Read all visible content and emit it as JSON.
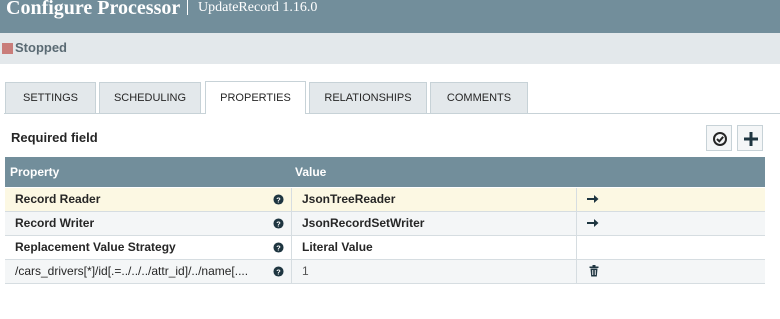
{
  "header": {
    "title": "Configure Processor",
    "subtitle": "UpdateRecord 1.16.0"
  },
  "status": {
    "label": "Stopped",
    "color": "#c97d7a"
  },
  "tabs": [
    {
      "label": "SETTINGS",
      "active": false
    },
    {
      "label": "SCHEDULING",
      "active": false
    },
    {
      "label": "PROPERTIES",
      "active": true
    },
    {
      "label": "RELATIONSHIPS",
      "active": false
    },
    {
      "label": "COMMENTS",
      "active": false
    }
  ],
  "properties_panel": {
    "required_label": "Required field",
    "verify_icon": "check-circle-icon",
    "add_icon": "plus-icon"
  },
  "grid": {
    "columns": [
      "Property",
      "Value"
    ],
    "rows": [
      {
        "name": "Record Reader",
        "value": "JsonTreeReader",
        "required": true,
        "action_icon": "arrow-right-icon"
      },
      {
        "name": "Record Writer",
        "value": "JsonRecordSetWriter",
        "required": true,
        "action_icon": "arrow-right-icon"
      },
      {
        "name": "Replacement Value Strategy",
        "value": "Literal Value",
        "required": true,
        "action_icon": ""
      },
      {
        "name": "/cars_drivers[*]/id[.=../../../attr_id]/../name[....",
        "value": "1",
        "required": false,
        "action_icon": "trash-icon"
      }
    ]
  },
  "colors": {
    "header_bg": "#728e9b",
    "status_bar_bg": "#e3e8eb",
    "highlight_row": "#fcf8e3"
  }
}
